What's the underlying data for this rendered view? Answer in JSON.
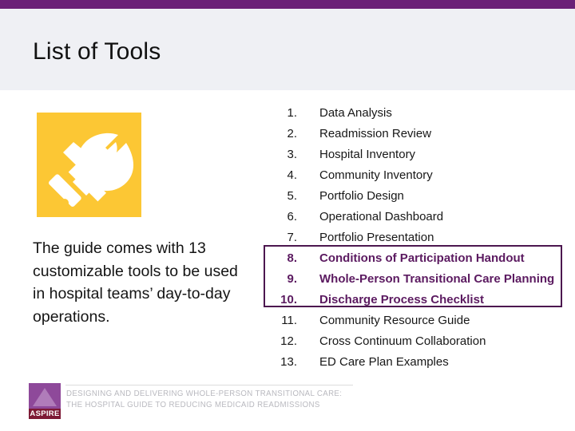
{
  "theme": {
    "accent_purple": "#6b2077",
    "header_bg": "#eff0f4",
    "icon_yellow": "#fcc734",
    "highlight_purple": "#5b1a60",
    "box_border": "#4c174f",
    "logo_purple": "#8e499a",
    "logo_band": "#7d1935"
  },
  "header": {
    "title": "List of Tools"
  },
  "left": {
    "icon_name": "tools-hammer-wrench-icon",
    "body_text": "The guide comes with 13 customizable tools to be used in hospital teams’ day-to-day operations."
  },
  "tools": [
    {
      "num": "1.",
      "label": "Data Analysis",
      "highlight": false
    },
    {
      "num": "2.",
      "label": "Readmission Review",
      "highlight": false
    },
    {
      "num": "3.",
      "label": "Hospital Inventory",
      "highlight": false
    },
    {
      "num": "4.",
      "label": "Community Inventory",
      "highlight": false
    },
    {
      "num": "5.",
      "label": "Portfolio Design",
      "highlight": false
    },
    {
      "num": "6.",
      "label": "Operational Dashboard",
      "highlight": false
    },
    {
      "num": "7.",
      "label": "Portfolio Presentation",
      "highlight": false
    },
    {
      "num": "8.",
      "label": "Conditions of Participation Handout",
      "highlight": true
    },
    {
      "num": "9.",
      "label": "Whole-Person Transitional Care Planning",
      "highlight": true
    },
    {
      "num": "10.",
      "label": "Discharge Process Checklist",
      "highlight": true
    },
    {
      "num": "11.",
      "label": "Community Resource Guide",
      "highlight": false
    },
    {
      "num": "12.",
      "label": "Cross Continuum Collaboration",
      "highlight": false
    },
    {
      "num": "13.",
      "label": "ED Care Plan Examples",
      "highlight": false
    }
  ],
  "footer": {
    "logo_wordmark": "ASPIRE",
    "tagline_line1": "DESIGNING AND DELIVERING WHOLE-PERSON TRANSITIONAL CARE:",
    "tagline_line2": "THE HOSPITAL GUIDE TO REDUCING MEDICAID READMISSIONS"
  }
}
